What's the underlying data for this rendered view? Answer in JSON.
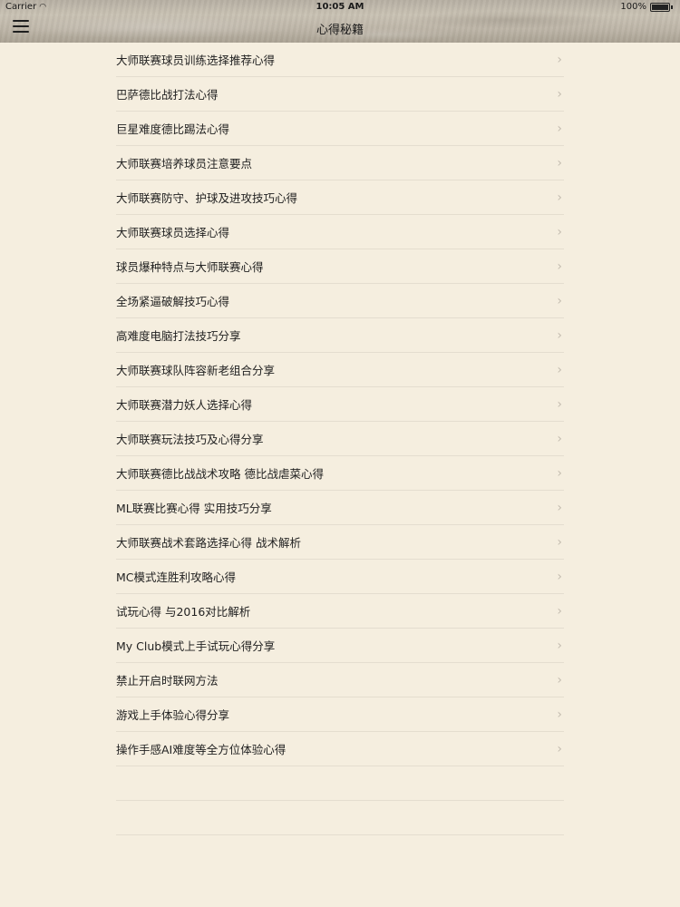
{
  "status_bar": {
    "carrier": "Carrier",
    "time": "10:05 AM",
    "battery": "100%"
  },
  "nav": {
    "title": "心得秘籍"
  },
  "items": [
    {
      "label": "大师联赛球员训练选择推荐心得"
    },
    {
      "label": "巴萨德比战打法心得"
    },
    {
      "label": "巨星难度德比踢法心得"
    },
    {
      "label": "大师联赛培养球员注意要点"
    },
    {
      "label": "大师联赛防守、护球及进攻技巧心得"
    },
    {
      "label": "大师联赛球员选择心得"
    },
    {
      "label": "球员爆种特点与大师联赛心得"
    },
    {
      "label": "全场紧逼破解技巧心得"
    },
    {
      "label": "高难度电脑打法技巧分享"
    },
    {
      "label": "大师联赛球队阵容新老组合分享"
    },
    {
      "label": "大师联赛潜力妖人选择心得"
    },
    {
      "label": "大师联赛玩法技巧及心得分享"
    },
    {
      "label": "大师联赛德比战战术攻略 德比战虐菜心得"
    },
    {
      "label": "ML联赛比赛心得 实用技巧分享"
    },
    {
      "label": "大师联赛战术套路选择心得 战术解析"
    },
    {
      "label": "MC模式连胜利攻略心得"
    },
    {
      "label": "试玩心得 与2016对比解析"
    },
    {
      "label": "My Club模式上手试玩心得分享"
    },
    {
      "label": "禁止开启时联网方法"
    },
    {
      "label": "游戏上手体验心得分享"
    },
    {
      "label": "操作手感AI难度等全方位体验心得"
    }
  ],
  "chevron_glyph": "›"
}
